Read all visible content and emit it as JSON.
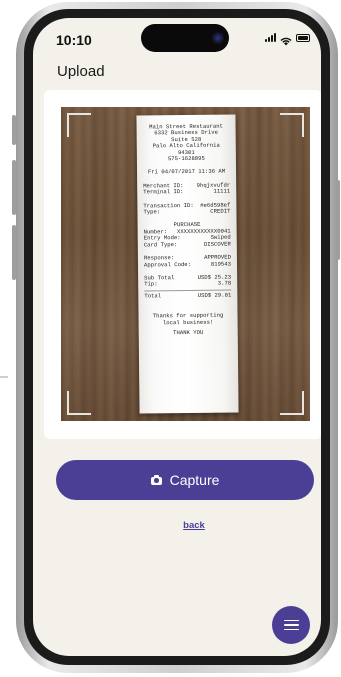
{
  "status_bar": {
    "time": "10:10"
  },
  "header": {
    "title": "Upload"
  },
  "receipt": {
    "header_lines": [
      "Main Street Restaurant",
      "6332 Business Drive",
      "Suite 528",
      "Palo Alto California 94301",
      "575-1628095"
    ],
    "datetime": "Fri 04/07/2017 11:36 AM",
    "merchant_id_label": "Merchant ID:",
    "merchant_id_value": "9hqjxvufdr",
    "terminal_id_label": "Terminal ID:",
    "terminal_id_value": "11111",
    "transaction_id_label": "Transaction ID:",
    "transaction_id_value": "#e6d598ef",
    "type_label": "Type:",
    "type_value": "CREDIT",
    "purchase_title": "PURCHASE",
    "number_label": "Number:",
    "number_value": "XXXXXXXXXXXX0041",
    "entry_mode_label": "Entry Mode:",
    "entry_mode_value": "Swiped",
    "card_type_label": "Card Type:",
    "card_type_value": "DISCOVER",
    "response_label": "Response:",
    "response_value": "APPROVED",
    "approval_label": "Approval Code:",
    "approval_value": "819543",
    "subtotal_label": "Sub Total",
    "subtotal_value": "USD$ 25.23",
    "tip_label": "Tip:",
    "tip_value": "3.78",
    "total_label": "Total",
    "total_value": "USD$ 29.01",
    "footer_lines": [
      "Thanks for supporting",
      "local business!"
    ],
    "thank_you": "THANK YOU"
  },
  "actions": {
    "capture_label": "Capture",
    "capture_icon": "camera-icon",
    "back_label": "back",
    "menu_icon": "hamburger-menu-icon"
  },
  "colors": {
    "accent": "#4a3f95",
    "screen_background": "#f4f0ea",
    "card_background": "#ffffff"
  }
}
